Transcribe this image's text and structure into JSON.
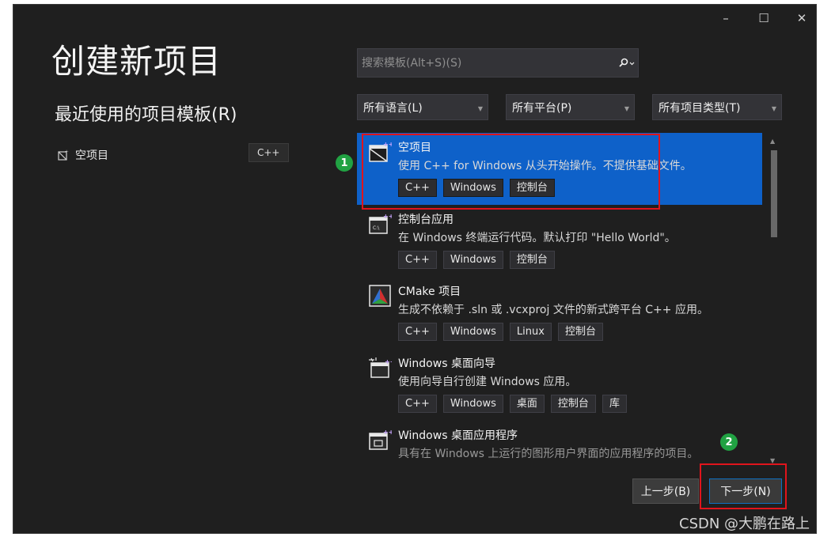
{
  "window": {
    "title": "创建新项目",
    "controls": {
      "minimize": "–",
      "maximize": "☐",
      "close": "✕"
    }
  },
  "recent": {
    "title": "最近使用的项目模板(R)",
    "items": [
      {
        "label": "空项目",
        "tag": "C++",
        "icon": "empty-project-icon"
      }
    ]
  },
  "search": {
    "placeholder": "搜索模板(Alt+S)(S)",
    "value": "",
    "icon": "search-icon"
  },
  "filters": {
    "language": "所有语言(L)",
    "platform": "所有平台(P)",
    "project_type": "所有项目类型(T)"
  },
  "templates": [
    {
      "name": "空项目",
      "description": "使用 C++ for Windows 从头开始操作。不提供基础文件。",
      "tags": [
        "C++",
        "Windows",
        "控制台"
      ],
      "icon": "empty-project-icon",
      "selected": true
    },
    {
      "name": "控制台应用",
      "description": "在 Windows 终端运行代码。默认打印 \"Hello World\"。",
      "tags": [
        "C++",
        "Windows",
        "控制台"
      ],
      "icon": "console-app-icon",
      "selected": false
    },
    {
      "name": "CMake 项目",
      "description": "生成不依赖于 .sln 或 .vcxproj 文件的新式跨平台 C++ 应用。",
      "tags": [
        "C++",
        "Windows",
        "Linux",
        "控制台"
      ],
      "icon": "cmake-icon",
      "selected": false
    },
    {
      "name": "Windows 桌面向导",
      "description": "使用向导自行创建 Windows 应用。",
      "tags": [
        "C++",
        "Windows",
        "桌面",
        "控制台",
        "库"
      ],
      "icon": "desktop-wizard-icon",
      "selected": false
    },
    {
      "name": "Windows 桌面应用程序",
      "description": "具有在 Windows 上运行的图形用户界面的应用程序的项目。",
      "tags": [],
      "icon": "desktop-app-icon",
      "selected": false
    }
  ],
  "annotations": {
    "badge_1": "1",
    "badge_2": "2",
    "color": "#e0141c",
    "badge_color": "#21a243"
  },
  "footer": {
    "back_label": "上一步(B)",
    "next_label": "下一步(N)"
  },
  "watermark": "CSDN @大鹏在路上",
  "colors": {
    "background": "#1f1f1f",
    "selected": "#0e61c9",
    "accent": "#0e70c0"
  }
}
